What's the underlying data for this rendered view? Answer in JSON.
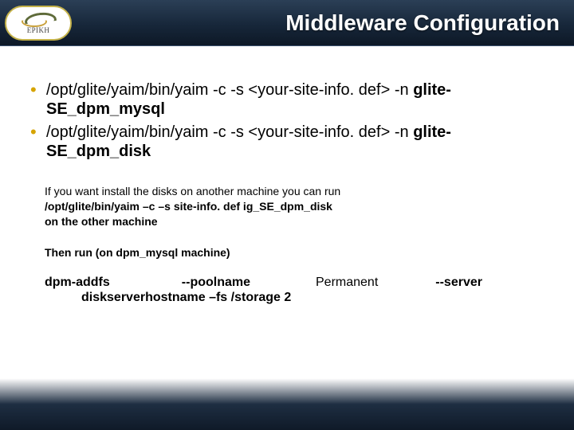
{
  "logo": {
    "text": "EPIKH"
  },
  "title": "Middleware Configuration",
  "bullets": [
    {
      "cmd": "/opt/glite/yaim/bin/yaim -c -s <your-site-info. def> -n",
      "target": "glite-SE_dpm_mysql"
    },
    {
      "cmd": "/opt/glite/yaim/bin/yaim -c -s <your-site-info. def> -n",
      "target": "glite-SE_dpm_disk"
    }
  ],
  "note": {
    "line1": "If you want install the disks on another machine you can run",
    "line2": "/opt/glite/bin/yaim –c –s site-info. def ig_SE_dpm_disk",
    "line3": "on the other machine"
  },
  "then_line": "Then run (on dpm_mysql machine)",
  "command": {
    "part1": "dpm-addfs",
    "part2": "--poolname",
    "part3": "Permanent",
    "part4": "--server",
    "line2": "diskserverhostname –fs /storage 2"
  }
}
